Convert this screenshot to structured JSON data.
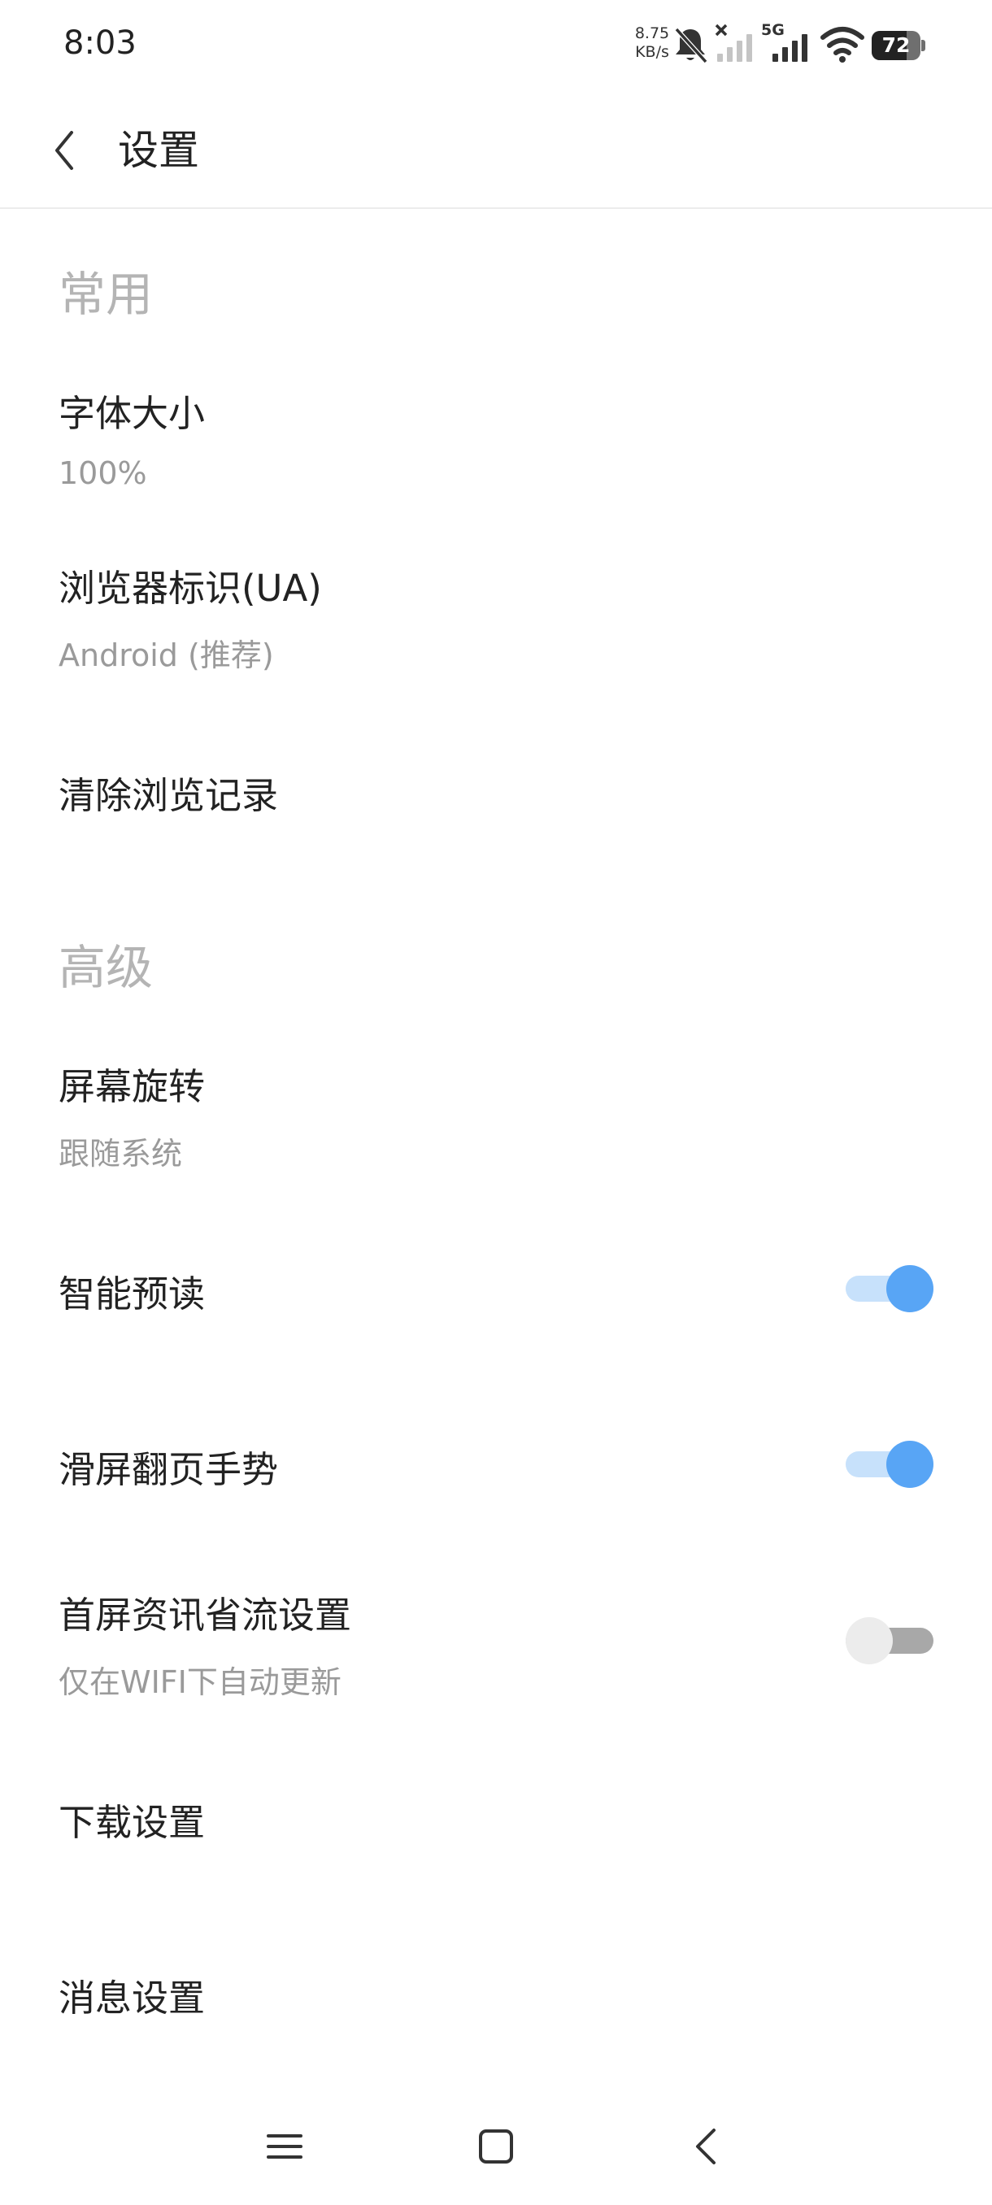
{
  "status_bar": {
    "time": "8:03",
    "net_speed_value": "8.75",
    "net_speed_unit": "KB/s",
    "network_label": "5G",
    "battery_level": "72",
    "icons": [
      "mute-icon",
      "no-signal-icon",
      "signal-5g-icon",
      "wifi-icon",
      "battery-icon"
    ]
  },
  "header": {
    "title": "设置",
    "back_icon": "chevron-left-icon"
  },
  "sections": {
    "common": {
      "title": "常用",
      "items": [
        {
          "title": "字体大小",
          "subtitle": "100%"
        },
        {
          "title": "浏览器标识(UA)",
          "subtitle": "Android (推荐)"
        },
        {
          "title": "清除浏览记录"
        }
      ]
    },
    "advanced": {
      "title": "高级",
      "items": [
        {
          "title": "屏幕旋转",
          "subtitle": "跟随系统"
        },
        {
          "title": "智能预读",
          "toggle": true
        },
        {
          "title": "滑屏翻页手势",
          "toggle": true
        },
        {
          "title": "首屏资讯省流设置",
          "subtitle": "仅在WIFI下自动更新",
          "toggle": false
        },
        {
          "title": "下载设置"
        },
        {
          "title": "消息设置"
        }
      ]
    }
  },
  "nav_bar": {
    "icons": [
      "menu-icon",
      "home-icon",
      "back-icon"
    ]
  },
  "colors": {
    "toggle_on_knob": "#58a5f5",
    "toggle_on_track": "#c7e1fb",
    "toggle_off_knob": "#ececec",
    "toggle_off_track": "#a8a8a8",
    "section_title": "#b4b4b4",
    "subtitle": "#9a9a9a"
  }
}
